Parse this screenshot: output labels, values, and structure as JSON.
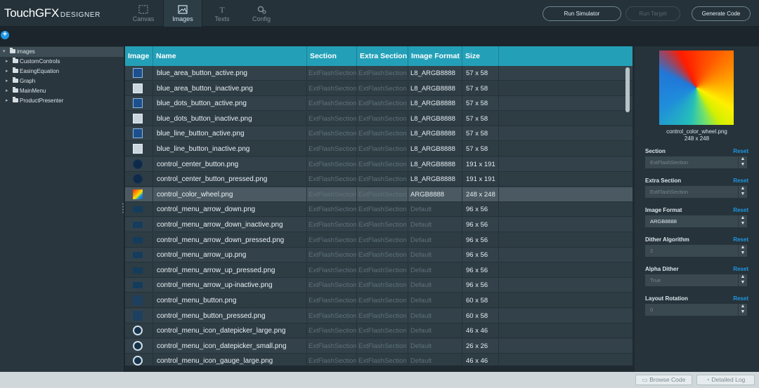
{
  "app": {
    "logo_main": "TouchGFX",
    "logo_sub": "DESIGNER"
  },
  "nav_tabs": [
    {
      "label": "Canvas",
      "icon": "canvas-icon"
    },
    {
      "label": "Images",
      "icon": "images-icon"
    },
    {
      "label": "Texts",
      "icon": "texts-icon"
    },
    {
      "label": "Config",
      "icon": "config-icon"
    }
  ],
  "toolbar": {
    "run_simulator": "Run Simulator",
    "run_target": "Run Target",
    "generate_code": "Generate Code"
  },
  "tree": {
    "root": "images",
    "items": [
      "CustomControls",
      "EasingEquation",
      "Graph",
      "MainMenu",
      "ProductPresenter"
    ]
  },
  "table": {
    "headers": [
      "Image",
      "Name",
      "Section",
      "Extra Section",
      "Image Format",
      "Size"
    ],
    "rows": [
      {
        "thumb": "button",
        "name": "blue_area_button_active.png",
        "section": "ExtFlashSection",
        "extra": "ExtFlashSection",
        "format": "L8_ARGB8888",
        "format_muted": false,
        "size": "57 x 58"
      },
      {
        "thumb": "button-inactive",
        "name": "blue_area_button_inactive.png",
        "section": "ExtFlashSection",
        "extra": "ExtFlashSection",
        "format": "L8_ARGB8888",
        "format_muted": false,
        "size": "57 x 58"
      },
      {
        "thumb": "button",
        "name": "blue_dots_button_active.png",
        "section": "ExtFlashSection",
        "extra": "ExtFlashSection",
        "format": "L8_ARGB8888",
        "format_muted": false,
        "size": "57 x 58"
      },
      {
        "thumb": "button-inactive",
        "name": "blue_dots_button_inactive.png",
        "section": "ExtFlashSection",
        "extra": "ExtFlashSection",
        "format": "L8_ARGB8888",
        "format_muted": false,
        "size": "57 x 58"
      },
      {
        "thumb": "button",
        "name": "blue_line_button_active.png",
        "section": "ExtFlashSection",
        "extra": "ExtFlashSection",
        "format": "L8_ARGB8888",
        "format_muted": false,
        "size": "57 x 58"
      },
      {
        "thumb": "button-inactive",
        "name": "blue_line_button_inactive.png",
        "section": "ExtFlashSection",
        "extra": "ExtFlashSection",
        "format": "L8_ARGB8888",
        "format_muted": false,
        "size": "57 x 58"
      },
      {
        "thumb": "circle",
        "name": "control_center_button.png",
        "section": "ExtFlashSection",
        "extra": "ExtFlashSection",
        "format": "L8_ARGB8888",
        "format_muted": false,
        "size": "191 x 191"
      },
      {
        "thumb": "circle",
        "name": "control_center_button_pressed.png",
        "section": "ExtFlashSection",
        "extra": "ExtFlashSection",
        "format": "L8_ARGB8888",
        "format_muted": false,
        "size": "191 x 191"
      },
      {
        "thumb": "wheel",
        "name": "control_color_wheel.png",
        "section": "ExtFlashSection",
        "extra": "ExtFlashSection",
        "format": "ARGB8888",
        "format_muted": false,
        "size": "248 x 248",
        "selected": true
      },
      {
        "thumb": "arrow",
        "name": "control_menu_arrow_down.png",
        "section": "ExtFlashSection",
        "extra": "ExtFlashSection",
        "format": "Default",
        "format_muted": true,
        "size": "96 x 56"
      },
      {
        "thumb": "arrow",
        "name": "control_menu_arrow_down_inactive.png",
        "section": "ExtFlashSection",
        "extra": "ExtFlashSection",
        "format": "Default",
        "format_muted": true,
        "size": "96 x 56"
      },
      {
        "thumb": "arrow",
        "name": "control_menu_arrow_down_pressed.png",
        "section": "ExtFlashSection",
        "extra": "ExtFlashSection",
        "format": "Default",
        "format_muted": true,
        "size": "96 x 56"
      },
      {
        "thumb": "arrow",
        "name": "control_menu_arrow_up.png",
        "section": "ExtFlashSection",
        "extra": "ExtFlashSection",
        "format": "Default",
        "format_muted": true,
        "size": "96 x 56"
      },
      {
        "thumb": "arrow",
        "name": "control_menu_arrow_up_pressed.png",
        "section": "ExtFlashSection",
        "extra": "ExtFlashSection",
        "format": "Default",
        "format_muted": true,
        "size": "96 x 56"
      },
      {
        "thumb": "arrow",
        "name": "control_menu_arrow_up-inactive.png",
        "section": "ExtFlashSection",
        "extra": "ExtFlashSection",
        "format": "Default",
        "format_muted": true,
        "size": "96 x 56"
      },
      {
        "thumb": "menu",
        "name": "control_menu_button.png",
        "section": "ExtFlashSection",
        "extra": "ExtFlashSection",
        "format": "Default",
        "format_muted": true,
        "size": "60 x 58"
      },
      {
        "thumb": "menu",
        "name": "control_menu_button_pressed.png",
        "section": "ExtFlashSection",
        "extra": "ExtFlashSection",
        "format": "Default",
        "format_muted": true,
        "size": "60 x 58"
      },
      {
        "thumb": "ring",
        "name": "control_menu_icon_datepicker_large.png",
        "section": "ExtFlashSection",
        "extra": "ExtFlashSection",
        "format": "Default",
        "format_muted": true,
        "size": "46 x 46"
      },
      {
        "thumb": "ring",
        "name": "control_menu_icon_datepicker_small.png",
        "section": "ExtFlashSection",
        "extra": "ExtFlashSection",
        "format": "Default",
        "format_muted": true,
        "size": "26 x 26"
      },
      {
        "thumb": "ring",
        "name": "control_menu_icon_gauge_large.png",
        "section": "ExtFlashSection",
        "extra": "ExtFlashSection",
        "format": "Default",
        "format_muted": true,
        "size": "46 x 46"
      }
    ]
  },
  "properties": {
    "preview_name": "control_color_wheel.png",
    "preview_size": "248 x 248",
    "reset_label": "Reset",
    "fields": [
      {
        "label": "Section",
        "value": "ExtFlashSection",
        "bright": false
      },
      {
        "label": "Extra Section",
        "value": "ExtFlashSection",
        "bright": false
      },
      {
        "label": "Image Format",
        "value": "ARGB8888",
        "bright": true
      },
      {
        "label": "Dither Algorithm",
        "value": "2",
        "bright": false
      },
      {
        "label": "Alpha Dither",
        "value": "True",
        "bright": false
      },
      {
        "label": "Layout Rotation",
        "value": "0",
        "bright": false
      }
    ]
  },
  "footer": {
    "browse_code": "Browse Code",
    "detailed_log": "Detailed Log"
  },
  "colors": {
    "accent": "#23a0b8",
    "link": "#1e98e6"
  }
}
